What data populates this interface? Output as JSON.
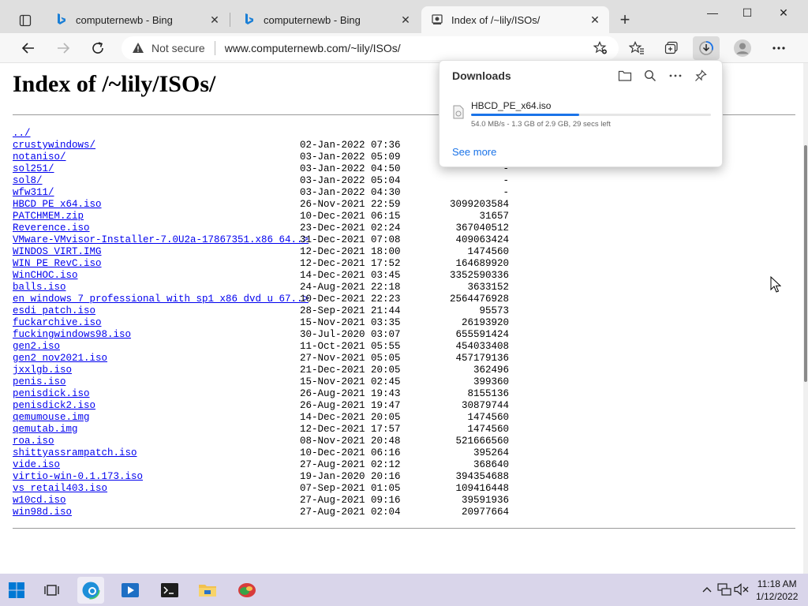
{
  "browser": {
    "tabs": [
      {
        "title": "computernewb - Bing",
        "favicon": "bing-icon",
        "active": false
      },
      {
        "title": "computernewb - Bing",
        "favicon": "bing-icon",
        "active": false
      },
      {
        "title": "Index of /~lily/ISOs/",
        "favicon": "globe-icon",
        "active": true
      }
    ],
    "tab_close_glyph": "✕",
    "new_tab_glyph": "+",
    "window_controls": {
      "minimize": "—",
      "maximize": "☐",
      "close": "✕"
    },
    "address": {
      "security_label": "Not secure",
      "url": "www.computernewb.com/~lily/ISOs/"
    }
  },
  "page": {
    "heading": "Index of /~lily/ISOs/",
    "entries": [
      {
        "name": "../",
        "date": "",
        "size": ""
      },
      {
        "name": "crustywindows/",
        "date": "02-Jan-2022 07:36",
        "size": "-"
      },
      {
        "name": "notaniso/",
        "date": "03-Jan-2022 05:09",
        "size": "-"
      },
      {
        "name": "sol251/",
        "date": "03-Jan-2022 04:50",
        "size": "-"
      },
      {
        "name": "sol8/",
        "date": "03-Jan-2022 05:04",
        "size": "-"
      },
      {
        "name": "wfw311/",
        "date": "03-Jan-2022 04:30",
        "size": "-"
      },
      {
        "name": "HBCD_PE_x64.iso",
        "date": "26-Nov-2021 22:59",
        "size": "3099203584"
      },
      {
        "name": "PATCHMEM.zip",
        "date": "10-Dec-2021 06:15",
        "size": "31657"
      },
      {
        "name": "Reverence.iso",
        "date": "23-Dec-2021 02:24",
        "size": "367040512"
      },
      {
        "name": "VMware-VMvisor-Installer-7.0U2a-17867351.x86_64..>",
        "date": "31-Dec-2021 07:08",
        "size": "409063424"
      },
      {
        "name": "WINDOS_VIRT.IMG",
        "date": "12-Dec-2021 18:00",
        "size": "1474560"
      },
      {
        "name": "WIN_PE_RevC.iso",
        "date": "12-Dec-2021 17:52",
        "size": "164689920"
      },
      {
        "name": "WinCHOC.iso",
        "date": "14-Dec-2021 03:45",
        "size": "3352590336"
      },
      {
        "name": "balls.iso",
        "date": "24-Aug-2021 22:18",
        "size": "3633152"
      },
      {
        "name": "en_windows_7_professional_with_sp1_x86_dvd_u_67..>",
        "date": "10-Dec-2021 22:23",
        "size": "2564476928"
      },
      {
        "name": "esdi_patch.iso",
        "date": "28-Sep-2021 21:44",
        "size": "95573"
      },
      {
        "name": "fuckarchive.iso",
        "date": "15-Nov-2021 03:35",
        "size": "26193920"
      },
      {
        "name": "fuckingwindows98.iso",
        "date": "30-Jul-2020 03:07",
        "size": "655591424"
      },
      {
        "name": "gen2.iso",
        "date": "11-Oct-2021 05:55",
        "size": "454033408"
      },
      {
        "name": "gen2_nov2021.iso",
        "date": "27-Nov-2021 05:05",
        "size": "457179136"
      },
      {
        "name": "jxxlgb.iso",
        "date": "21-Dec-2021 20:05",
        "size": "362496"
      },
      {
        "name": "penis.iso",
        "date": "15-Nov-2021 02:45",
        "size": "399360"
      },
      {
        "name": "penisdick.iso",
        "date": "26-Aug-2021 19:43",
        "size": "8155136"
      },
      {
        "name": "penisdick2.iso",
        "date": "26-Aug-2021 19:47",
        "size": "30879744"
      },
      {
        "name": "qemumouse.img",
        "date": "14-Dec-2021 20:05",
        "size": "1474560"
      },
      {
        "name": "qemutab.img",
        "date": "12-Dec-2021 17:57",
        "size": "1474560"
      },
      {
        "name": "roa.iso",
        "date": "08-Nov-2021 20:48",
        "size": "521666560"
      },
      {
        "name": "shittyassrampatch.iso",
        "date": "10-Dec-2021 06:16",
        "size": "395264"
      },
      {
        "name": "vide.iso",
        "date": "27-Aug-2021 02:12",
        "size": "368640"
      },
      {
        "name": "virtio-win-0.1.173.iso",
        "date": "19-Jan-2020 20:16",
        "size": "394354688"
      },
      {
        "name": "vs_retail403.iso",
        "date": "07-Sep-2021 01:05",
        "size": "109416448"
      },
      {
        "name": "w10cd.iso",
        "date": "27-Aug-2021 09:16",
        "size": "39591936"
      },
      {
        "name": "win98d.iso",
        "date": "27-Aug-2021 02:04",
        "size": "20977664"
      }
    ]
  },
  "downloads_panel": {
    "title": "Downloads",
    "item": {
      "filename": "HBCD_PE_x64.iso",
      "status": "54.0 MB/s - 1.3 GB of 2.9 GB, 29 secs left",
      "progress": 0.45
    },
    "see_more": "See more"
  },
  "taskbar": {
    "time": "11:18 AM",
    "date": "1/12/2022"
  },
  "colors": {
    "link": "#0000ee",
    "accent": "#1a73e8",
    "tabbar_bg": "#dfdfdf",
    "taskbar_bg": "#d9d5ea"
  }
}
